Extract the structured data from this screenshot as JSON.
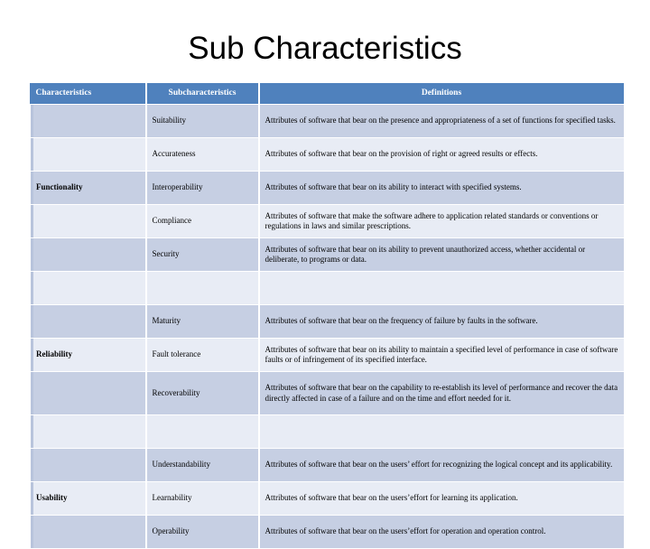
{
  "slide": {
    "title": "Sub Characteristics"
  },
  "table": {
    "headers": [
      "Characteristics",
      "Subcharacteristics",
      "Definitions"
    ],
    "header_bg": "#4F81BD",
    "band_dark": "#C6CFE3",
    "band_light": "#E8ECF5",
    "rows": [
      {
        "characteristic": "",
        "subcharacteristic": "Suitability",
        "definition": "Attributes of software that bear on the presence and appropriateness of a set of functions for specified tasks.",
        "band": "dark",
        "lines": 2
      },
      {
        "characteristic": "",
        "subcharacteristic": "Accurateness",
        "definition": "Attributes of software that bear on the provision of right or agreed results or effects.",
        "band": "light",
        "lines": 2
      },
      {
        "characteristic": "Functionality",
        "subcharacteristic": "Interoperability",
        "definition": "Attributes of software that bear on its ability to interact with specified systems.",
        "band": "dark",
        "lines": 1
      },
      {
        "characteristic": "",
        "subcharacteristic": "Compliance",
        "definition": "Attributes of software that make the software adhere to application related standards or conventions or regulations in laws and similar prescriptions.",
        "band": "light",
        "lines": 2
      },
      {
        "characteristic": "",
        "subcharacteristic": "Security",
        "definition": "Attributes of software that bear on its ability to prevent unauthorized access, whether accidental or deliberate, to programs or data.",
        "band": "dark",
        "lines": 2
      },
      {
        "characteristic": "",
        "subcharacteristic": "",
        "definition": "",
        "band": "light",
        "lines": 0
      },
      {
        "characteristic": "",
        "subcharacteristic": "Maturity",
        "definition": "Attributes of software that bear on the frequency of failure by faults in the software.",
        "band": "dark",
        "lines": 2
      },
      {
        "characteristic": "Reliability",
        "subcharacteristic": "Fault tolerance",
        "definition": "Attributes of software that bear on its ability to maintain a specified level of performance in case of software faults or of infringement of its specified interface.",
        "band": "light",
        "lines": 2
      },
      {
        "characteristic": "",
        "subcharacteristic": "Recoverability",
        "definition": "Attributes of software that bear on the capability to re-establish its level of performance and recover the data directly affected in case of a failure and on the time and effort needed for it.",
        "band": "dark",
        "lines": 3
      },
      {
        "characteristic": "",
        "subcharacteristic": "",
        "definition": "",
        "band": "light",
        "lines": 0
      },
      {
        "characteristic": "",
        "subcharacteristic": "Understandability",
        "definition": "Attributes of software that bear on the users’ effort for recognizing the logical concept and its applicability.",
        "band": "dark",
        "lines": 2
      },
      {
        "characteristic": "Usability",
        "subcharacteristic": "Learnability",
        "definition": "Attributes of software that bear on the users’effort for learning its application.",
        "band": "light",
        "lines": 1
      },
      {
        "characteristic": "",
        "subcharacteristic": "Operability",
        "definition": "Attributes of software that bear on the users’effort for operation and operation control.",
        "band": "dark",
        "lines": 2
      }
    ]
  }
}
